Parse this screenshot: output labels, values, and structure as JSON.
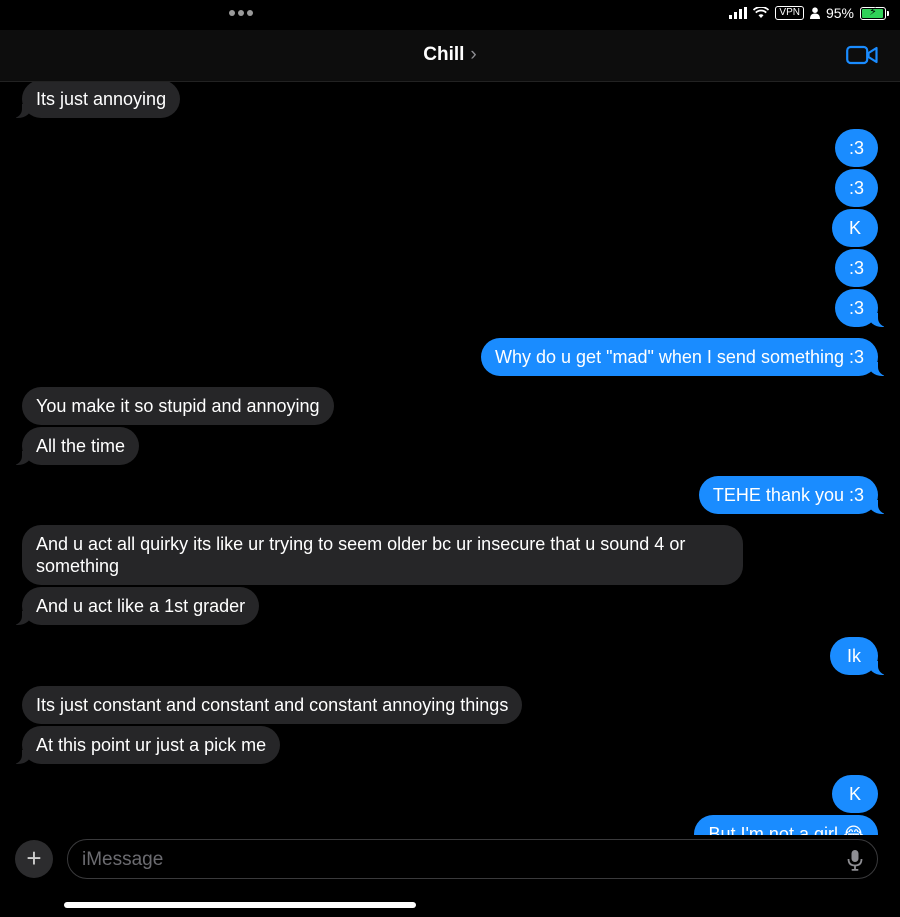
{
  "status_bar": {
    "vpn_label": "VPN",
    "battery_percent": "95%",
    "battery_level": 0.95
  },
  "header": {
    "contact_name": "Chill",
    "chevron": "›",
    "video_icon": "video-camera-icon"
  },
  "messages": [
    {
      "side": "in",
      "text": "Its just annoying"
    },
    {
      "side": "out",
      "text": ":3"
    },
    {
      "side": "out",
      "text": ":3"
    },
    {
      "side": "out",
      "text": "K"
    },
    {
      "side": "out",
      "text": ":3"
    },
    {
      "side": "out",
      "text": ":3"
    },
    {
      "side": "out",
      "text": "Why do u get \"mad\" when I send something :3"
    },
    {
      "side": "in",
      "text": "You make it so stupid and annoying"
    },
    {
      "side": "in",
      "text": "All the time"
    },
    {
      "side": "out",
      "text": "TEHE thank you :3"
    },
    {
      "side": "in",
      "text": "And u act all quirky its like ur trying to seem older bc ur insecure that u sound 4 or something"
    },
    {
      "side": "in",
      "text": "And u act like a 1st grader"
    },
    {
      "side": "out",
      "text": "Ik"
    },
    {
      "side": "in",
      "text": "Its just constant and constant and constant annoying things"
    },
    {
      "side": "in",
      "text": "At this point ur just a pick me"
    },
    {
      "side": "out",
      "text": "K"
    },
    {
      "side": "out",
      "text": "But I'm not a girl 😂"
    }
  ],
  "composer": {
    "plus_label": "+",
    "placeholder": "iMessage",
    "mic_icon": "microphone-icon"
  },
  "colors": {
    "outgoing": "#1a8cff",
    "incoming": "#262628",
    "background": "#000000"
  }
}
